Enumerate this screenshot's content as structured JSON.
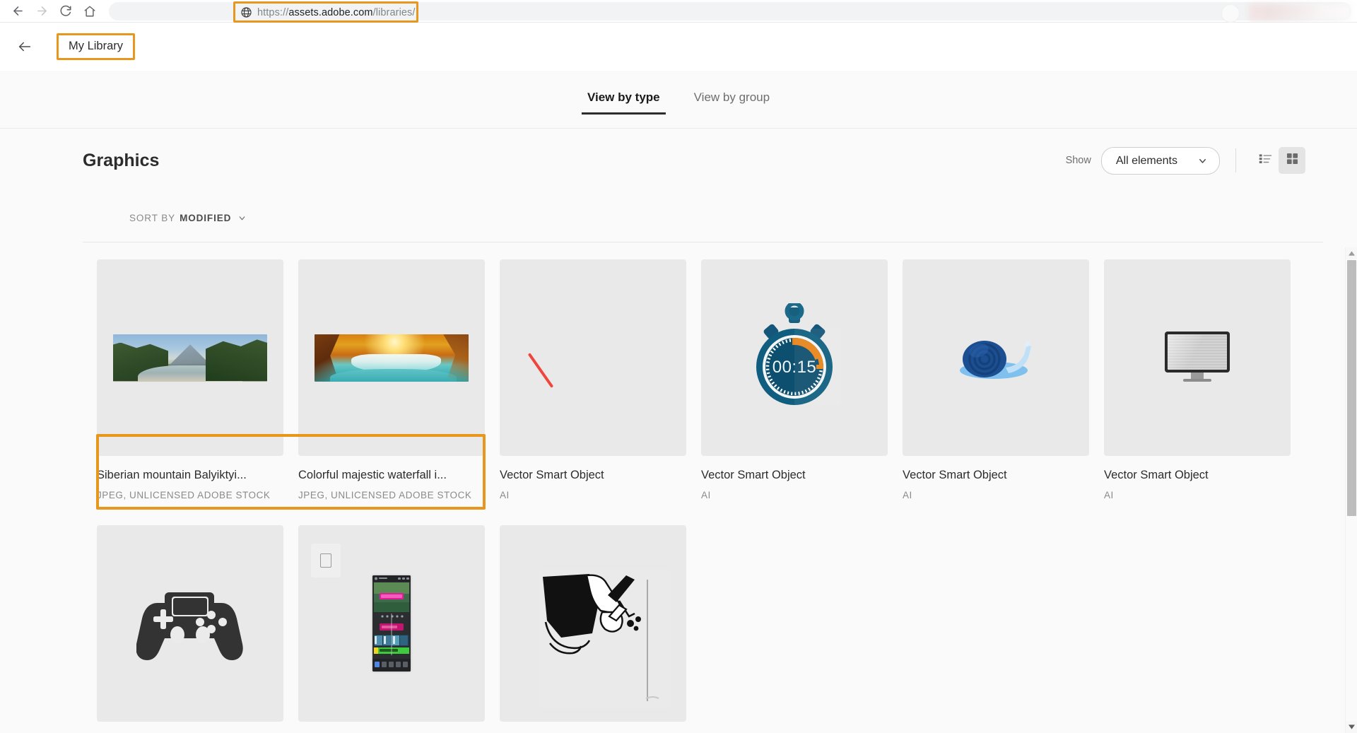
{
  "browser": {
    "back_icon": "back-arrow-icon",
    "forward_icon": "forward-arrow-icon",
    "reload_icon": "reload-icon",
    "home_icon": "home-icon",
    "site_icon": "globe-icon",
    "url_scheme": "https://",
    "url_domain": "assets.adobe.com",
    "url_path": "/libraries/",
    "url_full": "https://assets.adobe.com/libraries/",
    "highlight_color": "#e8971e"
  },
  "app_header": {
    "back_icon": "back-arrow-icon",
    "library_button_label": "My Library"
  },
  "tabs": [
    {
      "label": "View by type",
      "active": true
    },
    {
      "label": "View by group",
      "active": false
    }
  ],
  "section": {
    "title": "Graphics",
    "show_label": "Show",
    "filter_value": "All elements",
    "filter_chevron": "chevron-down-icon",
    "list_view_icon": "list-view-icon",
    "grid_view_icon": "grid-view-icon",
    "active_view": "grid"
  },
  "sort": {
    "prefix": "SORT BY",
    "value": "MODIFIED",
    "chevron": "chevron-down-icon"
  },
  "assets": [
    {
      "title": "Siberian mountain Balyiktyi...",
      "meta": "JPEG, UNLICENSED ADOBE STOCK",
      "art": "photo-mountain",
      "selected": true
    },
    {
      "title": "Colorful majestic waterfall i...",
      "meta": "JPEG, UNLICENSED ADOBE STOCK",
      "art": "photo-waterfall",
      "selected": true
    },
    {
      "title": "Vector Smart Object",
      "meta": "AI",
      "art": "red-diagonal-line",
      "selected": false
    },
    {
      "title": "Vector Smart Object",
      "meta": "AI",
      "art": "stopwatch",
      "selected": false
    },
    {
      "title": "Vector Smart Object",
      "meta": "AI",
      "art": "snail",
      "selected": false
    },
    {
      "title": "Vector Smart Object",
      "meta": "AI",
      "art": "monitor",
      "selected": false
    },
    {
      "title": "",
      "meta": "",
      "art": "gamepad",
      "selected": false
    },
    {
      "title": "",
      "meta": "",
      "art": "phone-video-editor",
      "selected": false
    },
    {
      "title": "",
      "meta": "",
      "art": "hand-sketch",
      "selected": false
    }
  ],
  "stopwatch": {
    "display": "00:15",
    "dial_color": "#0d5072",
    "accent_color": "#e8841a"
  },
  "scrollbar": {
    "up_arrow_icon": "scroll-up-icon",
    "down_arrow_icon": "scroll-down-icon"
  }
}
